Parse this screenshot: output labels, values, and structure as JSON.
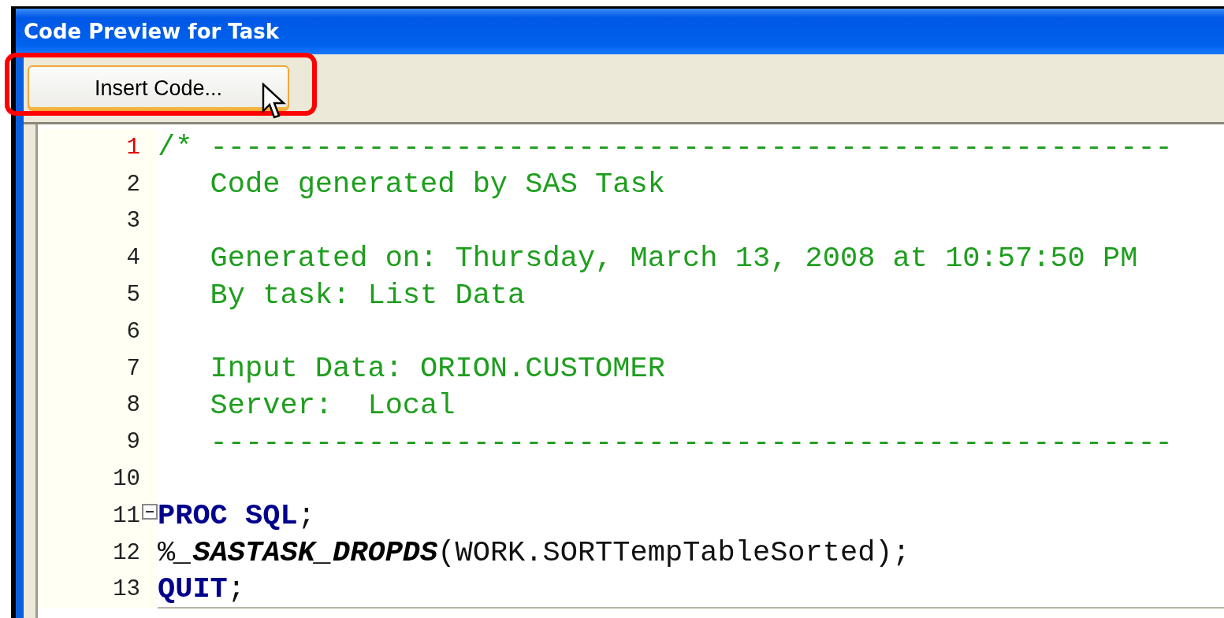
{
  "window": {
    "title": "Code Preview for Task"
  },
  "toolbar": {
    "buttons": [
      {
        "label": "Insert Code...",
        "highlighted": true
      }
    ]
  },
  "editor": {
    "lines": [
      {
        "number": "1",
        "current": true,
        "segments": [
          {
            "kind": "comment",
            "text": "/* -------------------------------------------------------"
          }
        ]
      },
      {
        "number": "2",
        "current": false,
        "segments": [
          {
            "kind": "comment",
            "text": "   Code generated by SAS Task"
          }
        ]
      },
      {
        "number": "3",
        "current": false
      },
      {
        "number": "4",
        "current": false,
        "segments": [
          {
            "kind": "comment",
            "text": "   Generated on: Thursday, March 13, 2008 at 10:57:50 PM"
          }
        ]
      },
      {
        "number": "5",
        "current": false,
        "segments": [
          {
            "kind": "comment",
            "text": "   By task: List Data"
          }
        ]
      },
      {
        "number": "6",
        "current": false
      },
      {
        "number": "7",
        "current": false,
        "segments": [
          {
            "kind": "comment",
            "text": "   Input Data: ORION.CUSTOMER"
          }
        ]
      },
      {
        "number": "8",
        "current": false,
        "segments": [
          {
            "kind": "comment",
            "text": "   Server:  Local"
          }
        ]
      },
      {
        "number": "9",
        "current": false,
        "segments": [
          {
            "kind": "comment",
            "text": "   -------------------------------------------------------"
          }
        ]
      },
      {
        "number": "10",
        "current": false
      },
      {
        "number": "11",
        "current": false,
        "foldable": true,
        "expanded": true,
        "segments": [
          {
            "kind": "keyword",
            "text": "PROC SQL"
          },
          {
            "kind": "plain",
            "text": ";"
          }
        ]
      },
      {
        "number": "12",
        "current": false,
        "segments": [
          {
            "kind": "plain",
            "text": "%"
          },
          {
            "kind": "macro",
            "text": "_SASTASK_DROPDS"
          },
          {
            "kind": "plain",
            "text": "(WORK.SORTTempTableSorted);"
          }
        ]
      },
      {
        "number": "13",
        "current": false,
        "segments": [
          {
            "kind": "keyword",
            "text": "QUIT"
          },
          {
            "kind": "plain",
            "text": ";"
          }
        ]
      }
    ]
  }
}
